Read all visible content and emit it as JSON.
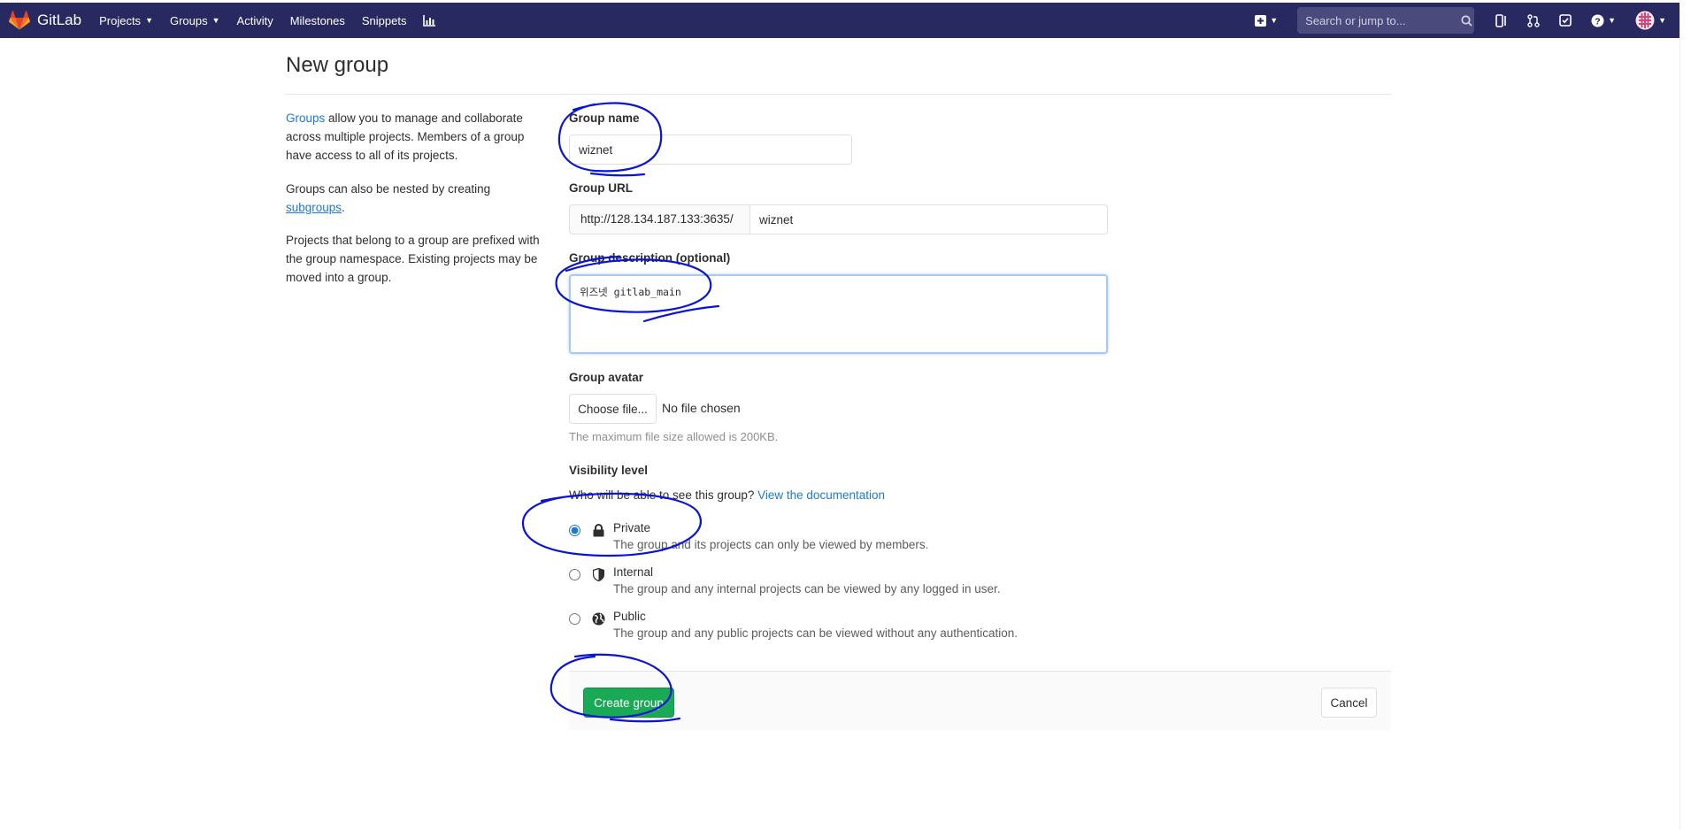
{
  "navbar": {
    "brand": "GitLab",
    "items": [
      {
        "label": "Projects",
        "dropdown": true
      },
      {
        "label": "Groups",
        "dropdown": true
      },
      {
        "label": "Activity",
        "dropdown": false
      },
      {
        "label": "Milestones",
        "dropdown": false
      },
      {
        "label": "Snippets",
        "dropdown": false
      }
    ],
    "search_placeholder": "Search or jump to...",
    "colors": {
      "background": "#292961",
      "search_bg": "#4a4a7d"
    }
  },
  "page": {
    "title": "New group"
  },
  "sidebar": {
    "p1_link": "Groups",
    "p1_text": " allow you to manage and collaborate across multiple projects. Members of a group have access to all of its projects.",
    "p2_text": "Groups can also be nested by creating ",
    "p2_link": "subgroups",
    "p2_end": ".",
    "p3_text": "Projects that belong to a group are prefixed with the group namespace. Existing projects may be moved into a group."
  },
  "form": {
    "group_name_label": "Group name",
    "group_name_value": "wiznet",
    "group_url_label": "Group URL",
    "group_url_prefix": "http://128.134.187.133:3635/",
    "group_url_value": "wiznet",
    "description_label": "Group description (optional)",
    "description_value": "위즈넷 gitlab_main ",
    "avatar_label": "Group avatar",
    "choose_file_label": "Choose file...",
    "no_file_text": "No file chosen",
    "file_help": "The maximum file size allowed is 200KB.",
    "visibility_label": "Visibility level",
    "visibility_question": "Who will be able to see this group?",
    "visibility_doc_link": "View the documentation",
    "visibility_options": [
      {
        "title": "Private",
        "desc": "The group and its projects can only be viewed by members.",
        "icon": "lock-icon",
        "checked": true
      },
      {
        "title": "Internal",
        "desc": "The group and any internal projects can be viewed by any logged in user.",
        "icon": "shield-icon",
        "checked": false
      },
      {
        "title": "Public",
        "desc": "The group and any public projects can be viewed without any authentication.",
        "icon": "globe-icon",
        "checked": false
      }
    ],
    "create_button": "Create group",
    "cancel_button": "Cancel"
  },
  "colors": {
    "link": "#1f78d1",
    "create_button": "#1aaa55",
    "annotation_ink": "#0a14d6"
  }
}
